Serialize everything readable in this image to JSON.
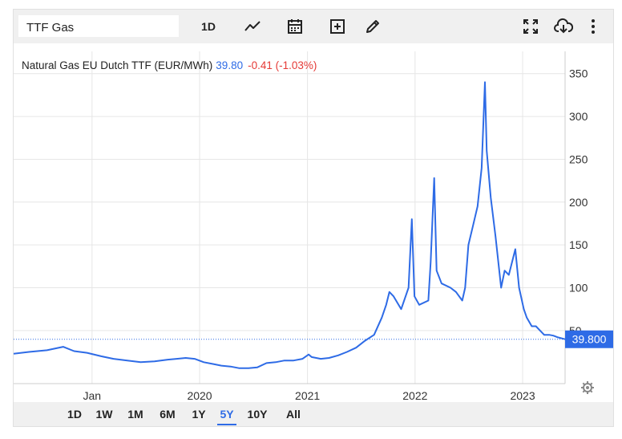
{
  "toolbar": {
    "symbol_value": "TTF Gas",
    "interval_label": "1D",
    "icons": [
      "line-chart-icon",
      "calendar-icon",
      "add-indicator-icon",
      "draw-pencil-icon",
      "fullscreen-icon",
      "cloud-download-icon",
      "more-vertical-icon"
    ]
  },
  "legend": {
    "name": "Natural Gas EU Dutch TTF (EUR/MWh)",
    "price": "39.80",
    "change": "-0.41 (-1.03%)"
  },
  "last_price_label": "39.800",
  "range_buttons": [
    {
      "label": "1D",
      "active": false
    },
    {
      "label": "1W",
      "active": false
    },
    {
      "label": "1M",
      "active": false
    },
    {
      "label": "6M",
      "active": false
    },
    {
      "label": "1Y",
      "active": false
    },
    {
      "label": "5Y",
      "active": true
    },
    {
      "label": "10Y",
      "active": false
    },
    {
      "label": "All",
      "active": false
    }
  ],
  "colors": {
    "line": "#2e6be6",
    "price_tag": "#2e6be6",
    "negative": "#e53935",
    "grid": "#e6e6e6"
  },
  "chart_data": {
    "type": "line",
    "title": "Natural Gas EU Dutch TTF (EUR/MWh)",
    "xlabel": "",
    "ylabel": "",
    "x_tick_labels": [
      "Jan",
      "2020",
      "2021",
      "2022",
      "2023"
    ],
    "x_tick_dates": [
      "2019-01-01",
      "2020-01-01",
      "2021-01-01",
      "2022-01-01",
      "2023-01-01"
    ],
    "y_ticks": [
      50,
      100,
      150,
      200,
      250,
      300,
      350
    ],
    "ylim": [
      -12,
      376
    ],
    "xlim": [
      "2018-04-10",
      "2023-05-25"
    ],
    "grid": true,
    "series": [
      {
        "name": "",
        "x": [
          "2018-04-10",
          "2018-06-01",
          "2018-08-01",
          "2018-09-25",
          "2018-11-01",
          "2018-12-15",
          "2019-02-01",
          "2019-03-15",
          "2019-05-01",
          "2019-06-15",
          "2019-08-01",
          "2019-09-15",
          "2019-10-15",
          "2019-11-15",
          "2019-12-15",
          "2020-01-15",
          "2020-02-15",
          "2020-03-15",
          "2020-04-15",
          "2020-05-15",
          "2020-06-15",
          "2020-07-15",
          "2020-08-15",
          "2020-09-15",
          "2020-10-15",
          "2020-11-15",
          "2020-12-15",
          "2021-01-05",
          "2021-01-15",
          "2021-02-15",
          "2021-03-15",
          "2021-04-15",
          "2021-05-15",
          "2021-06-15",
          "2021-07-15",
          "2021-08-15",
          "2021-09-10",
          "2021-09-25",
          "2021-10-06",
          "2021-10-20",
          "2021-11-15",
          "2021-12-10",
          "2021-12-21",
          "2021-12-30",
          "2022-01-15",
          "2022-02-15",
          "2022-02-23",
          "2022-03-07",
          "2022-03-15",
          "2022-04-01",
          "2022-05-01",
          "2022-05-20",
          "2022-06-10",
          "2022-06-20",
          "2022-07-01",
          "2022-07-15",
          "2022-08-01",
          "2022-08-15",
          "2022-08-26",
          "2022-09-01",
          "2022-09-15",
          "2022-10-01",
          "2022-10-20",
          "2022-11-01",
          "2022-11-15",
          "2022-12-07",
          "2022-12-20",
          "2023-01-05",
          "2023-01-15",
          "2023-02-01",
          "2023-02-15",
          "2023-03-01",
          "2023-03-15",
          "2023-04-01",
          "2023-04-15",
          "2023-05-01",
          "2023-05-25"
        ],
        "y": [
          23,
          25,
          27,
          31,
          26,
          24,
          20,
          17,
          15,
          13,
          14,
          16,
          17,
          18,
          17,
          13,
          11,
          9,
          8,
          6,
          6,
          7,
          12,
          13,
          15,
          15,
          17,
          22,
          19,
          17,
          18,
          21,
          25,
          30,
          38,
          45,
          65,
          80,
          95,
          90,
          75,
          100,
          180,
          90,
          80,
          85,
          130,
          228,
          120,
          105,
          100,
          95,
          85,
          100,
          150,
          170,
          195,
          240,
          340,
          260,
          205,
          160,
          100,
          120,
          115,
          145,
          100,
          75,
          65,
          55,
          55,
          50,
          45,
          45,
          44,
          42,
          39.8
        ]
      }
    ]
  }
}
